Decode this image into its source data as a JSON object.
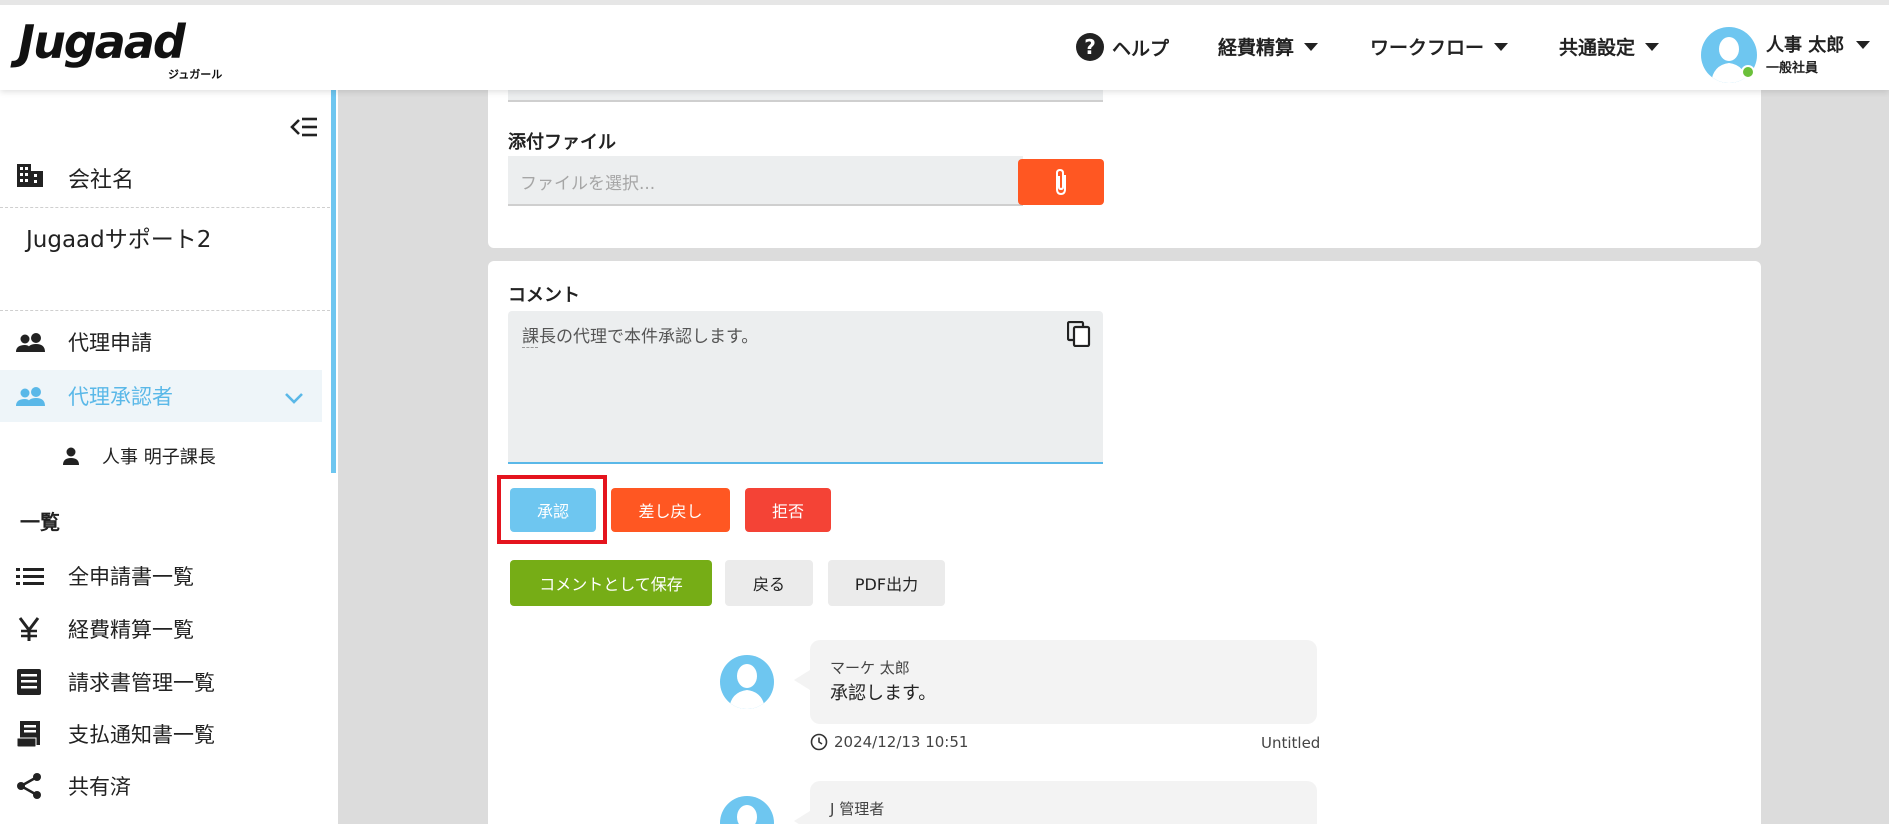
{
  "header": {
    "logo": "Jugaad",
    "logo_sub": "ジュガール",
    "nav": {
      "help": "ヘルプ",
      "expense": "経費精算",
      "workflow": "ワークフロー",
      "settings": "共通設定"
    },
    "user": {
      "name": "人事 太郎",
      "role": "一般社員",
      "status_color": "#6bc03a"
    }
  },
  "sidebar": {
    "company_label": "会社名",
    "company_value": "Jugaadサポート2",
    "items": [
      {
        "label": "代理申請",
        "icon": "people-icon"
      },
      {
        "label": "代理承認者",
        "icon": "people-icon",
        "active": true
      },
      {
        "label": "人事 明子課長",
        "icon": "person-icon"
      }
    ],
    "section_title": "一覧",
    "list_items": [
      {
        "label": "全申請書一覧",
        "icon": "list-icon"
      },
      {
        "label": "経費精算一覧",
        "icon": "yen-icon"
      },
      {
        "label": "請求書管理一覧",
        "icon": "invoice-icon"
      },
      {
        "label": "支払通知書一覧",
        "icon": "receipt-icon"
      },
      {
        "label": "共有済",
        "icon": "share-icon"
      }
    ]
  },
  "attachment": {
    "label": "添付ファイル",
    "placeholder": "ファイルを選択..."
  },
  "comment": {
    "label": "コメント",
    "value": "課長の代理で本件承認します。"
  },
  "actions": {
    "approve": "承認",
    "send_back": "差し戻し",
    "reject": "拒否",
    "save_comment": "コメントとして保存",
    "back": "戻る",
    "pdf": "PDF出力"
  },
  "history": [
    {
      "author": "マーケ 太郎",
      "text": "承認します。",
      "timestamp": "2024/12/13 10:51",
      "tag": "Untitled"
    },
    {
      "author": "J 管理者",
      "text": ""
    }
  ],
  "colors": {
    "accent": "#6ec6f0",
    "orange": "#ff5722",
    "red": "#f44336",
    "green": "#76ad16",
    "highlight": "#e4141e"
  }
}
